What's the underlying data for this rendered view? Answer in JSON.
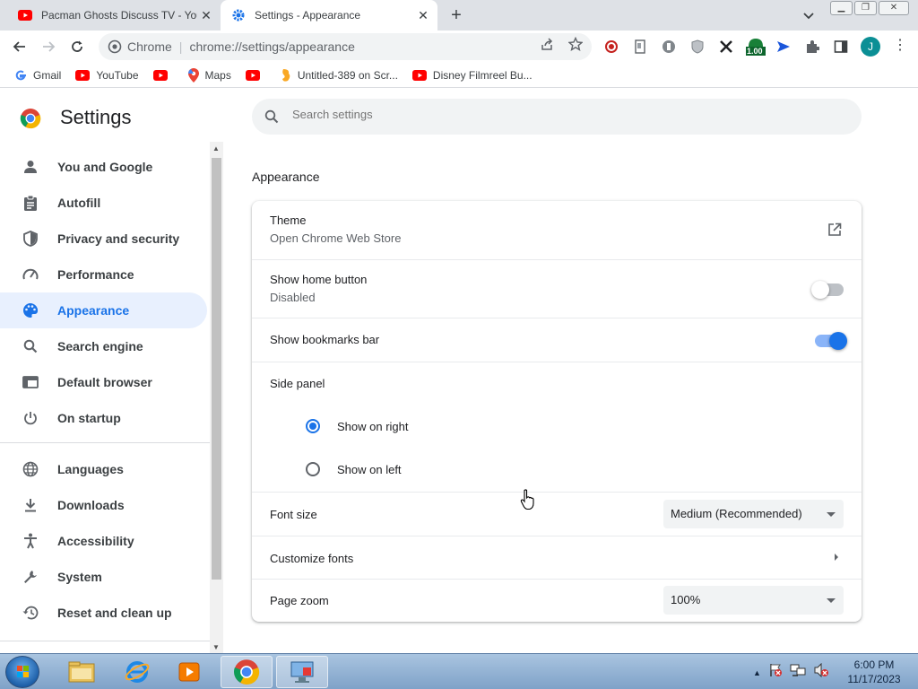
{
  "tabs": [
    {
      "title": "Pacman Ghosts Discuss TV - YouTube",
      "favicon": "youtube-icon",
      "active": false
    },
    {
      "title": "Settings - Appearance",
      "favicon": "settings-gear-icon",
      "active": true
    }
  ],
  "toolbar": {
    "chip_label": "Chrome",
    "url": "chrome://settings/appearance",
    "avatar_initial": "J",
    "extension_badge": "1.00"
  },
  "bookmarks": [
    {
      "label": "Gmail",
      "icon": "google-icon"
    },
    {
      "label": "YouTube",
      "icon": "youtube-icon"
    },
    {
      "label": "",
      "icon": "youtube-icon"
    },
    {
      "label": "Maps",
      "icon": "maps-icon"
    },
    {
      "label": "",
      "icon": "youtube-icon"
    },
    {
      "label": "Untitled-389 on Scr...",
      "icon": "scratch-icon"
    },
    {
      "label": "Disney Filmreel Bu...",
      "icon": "youtube-icon"
    }
  ],
  "settings": {
    "title": "Settings",
    "search_placeholder": "Search settings"
  },
  "sidebar": {
    "items": [
      {
        "label": "You and Google",
        "icon": "person-icon"
      },
      {
        "label": "Autofill",
        "icon": "clipboard-icon"
      },
      {
        "label": "Privacy and security",
        "icon": "shield-icon"
      },
      {
        "label": "Performance",
        "icon": "speedometer-icon"
      },
      {
        "label": "Appearance",
        "icon": "palette-icon",
        "active": true
      },
      {
        "label": "Search engine",
        "icon": "search-icon"
      },
      {
        "label": "Default browser",
        "icon": "browser-icon"
      },
      {
        "label": "On startup",
        "icon": "power-icon"
      },
      {
        "label": "Languages",
        "icon": "globe-icon"
      },
      {
        "label": "Downloads",
        "icon": "download-icon"
      },
      {
        "label": "Accessibility",
        "icon": "accessibility-icon"
      },
      {
        "label": "System",
        "icon": "wrench-icon"
      },
      {
        "label": "Reset and clean up",
        "icon": "history-icon"
      }
    ]
  },
  "appearance": {
    "section_title": "Appearance",
    "theme": {
      "label": "Theme",
      "sub": "Open Chrome Web Store"
    },
    "home_button": {
      "label": "Show home button",
      "sub": "Disabled",
      "enabled": false
    },
    "bookmarks_bar": {
      "label": "Show bookmarks bar",
      "enabled": true
    },
    "side_panel": {
      "label": "Side panel",
      "options": [
        "Show on right",
        "Show on left"
      ],
      "selected": "Show on right"
    },
    "font_size": {
      "label": "Font size",
      "value": "Medium (Recommended)"
    },
    "customize_fonts": {
      "label": "Customize fonts"
    },
    "page_zoom": {
      "label": "Page zoom",
      "value": "100%"
    }
  },
  "taskbar": {
    "time": "6:00 PM",
    "date": "11/17/2023"
  },
  "colors": {
    "accent": "#1a73e8",
    "active_nav_bg": "#e8f0fe",
    "tab_strip": "#dee1e6"
  }
}
